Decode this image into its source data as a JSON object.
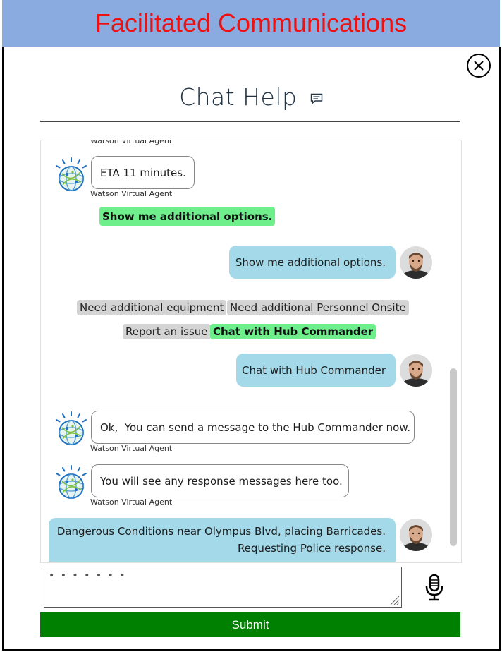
{
  "banner": {
    "title": "Facilitated Communications"
  },
  "header": {
    "title": "Chat Help"
  },
  "chat": {
    "agent_name": "Watson Virtual Agent",
    "messages": [
      {
        "from": "agent",
        "text": "ETA 11 minutes."
      },
      {
        "from": "agent-option",
        "text": "Show me additional options."
      },
      {
        "from": "user",
        "text": "Show me additional options."
      },
      {
        "from": "user",
        "text": "Chat with Hub Commander"
      },
      {
        "from": "agent",
        "text": "Ok,  You can send a message to the Hub Commander now."
      },
      {
        "from": "agent",
        "text": "You will see any response messages here too."
      },
      {
        "from": "user",
        "lines": [
          "Dangerous Conditions near Olympus Blvd, placing Barricades.",
          "Requesting Police response."
        ]
      }
    ],
    "options": [
      {
        "label": "Need additional equipment",
        "selected": false
      },
      {
        "label": "Need additional Personnel Onsite",
        "selected": false
      },
      {
        "label": "Report an issue",
        "selected": false
      },
      {
        "label": "Chat with Hub Commander",
        "selected": true
      }
    ]
  },
  "input": {
    "value": "• • • • • • •"
  },
  "submit": {
    "label": "Submit"
  },
  "colors": {
    "banner": "#8aabe0",
    "banner_text": "#ee1111",
    "user_bubble": "#a3d9e8",
    "chip_selected": "#6fef8c",
    "chip": "#d4d4d4",
    "submit": "#008000"
  },
  "icons": {
    "close": "close-icon",
    "chat": "chat-bubble-icon",
    "agent": "watson-globe-icon",
    "user": "user-avatar",
    "mic": "microphone-icon"
  }
}
